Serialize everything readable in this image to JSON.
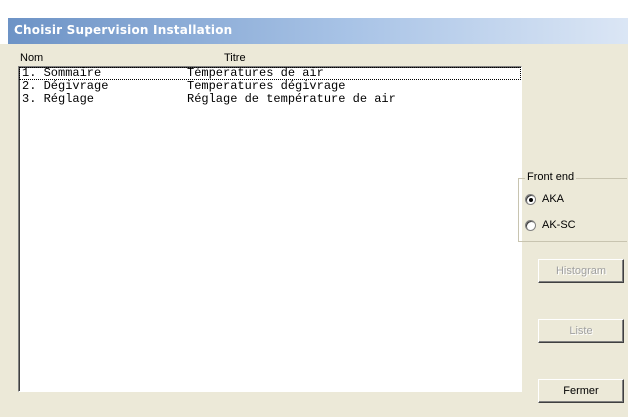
{
  "window": {
    "title": "Choisir Supervision Installation"
  },
  "columns": {
    "name": "Nom",
    "title": "Titre"
  },
  "rows": [
    {
      "name": "1. Sommaire",
      "title": "Témperatures de air"
    },
    {
      "name": "2. Dégivrage",
      "title": "Temperatures dégivrage"
    },
    {
      "name": "3. Réglage",
      "title": "Réglage de température de air"
    }
  ],
  "frontend": {
    "legend": "Front end",
    "options": [
      {
        "label": "AKA",
        "selected": true
      },
      {
        "label": "AK-SC",
        "selected": false
      }
    ]
  },
  "buttons": {
    "histogram": "Histogram",
    "list": "Liste",
    "close": "Fermer"
  },
  "colors": {
    "titlebar_start": "#6d93c6",
    "titlebar_end": "#dbe6f5",
    "face": "#ece9d8"
  }
}
